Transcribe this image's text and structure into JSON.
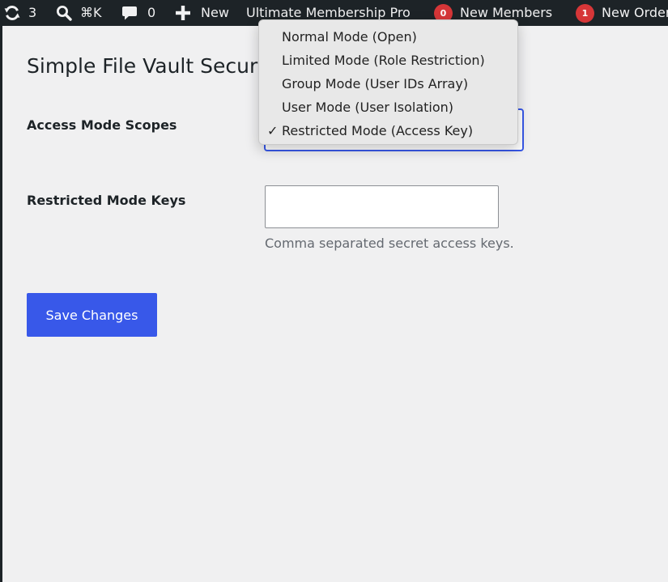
{
  "admin_bar": {
    "updates_count": "3",
    "search_shortcut": "⌘K",
    "comments_count": "0",
    "new_label": "New",
    "plugin_label": "Ultimate Membership Pro",
    "new_members_badge": "0",
    "new_members_label": "New Members",
    "new_orders_badge": "1",
    "new_orders_label": "New Orders"
  },
  "page": {
    "title": "Simple File Vault Security"
  },
  "form": {
    "access_mode_label": "Access Mode Scopes",
    "access_mode_options": [
      "Normal Mode (Open)",
      "Limited Mode (Role Restriction)",
      "Group Mode (User IDs Array)",
      "User Mode (User Isolation)",
      "Restricted Mode (Access Key)"
    ],
    "access_mode_selected": "Restricted Mode (Access Key)",
    "selected_check": "✓",
    "restricted_keys_label": "Restricted Mode Keys",
    "restricted_keys_value": "",
    "restricted_keys_description": "Comma separated secret access keys.",
    "save_label": "Save Changes"
  },
  "colors": {
    "admin_bar_bg": "#1d2327",
    "accent_blue": "#3858e9",
    "badge_red": "#d63638",
    "page_bg": "#f0f0f1"
  },
  "icons": {
    "updates": "refresh-icon",
    "search": "search-icon",
    "comments": "comment-icon",
    "new": "plus-icon"
  }
}
